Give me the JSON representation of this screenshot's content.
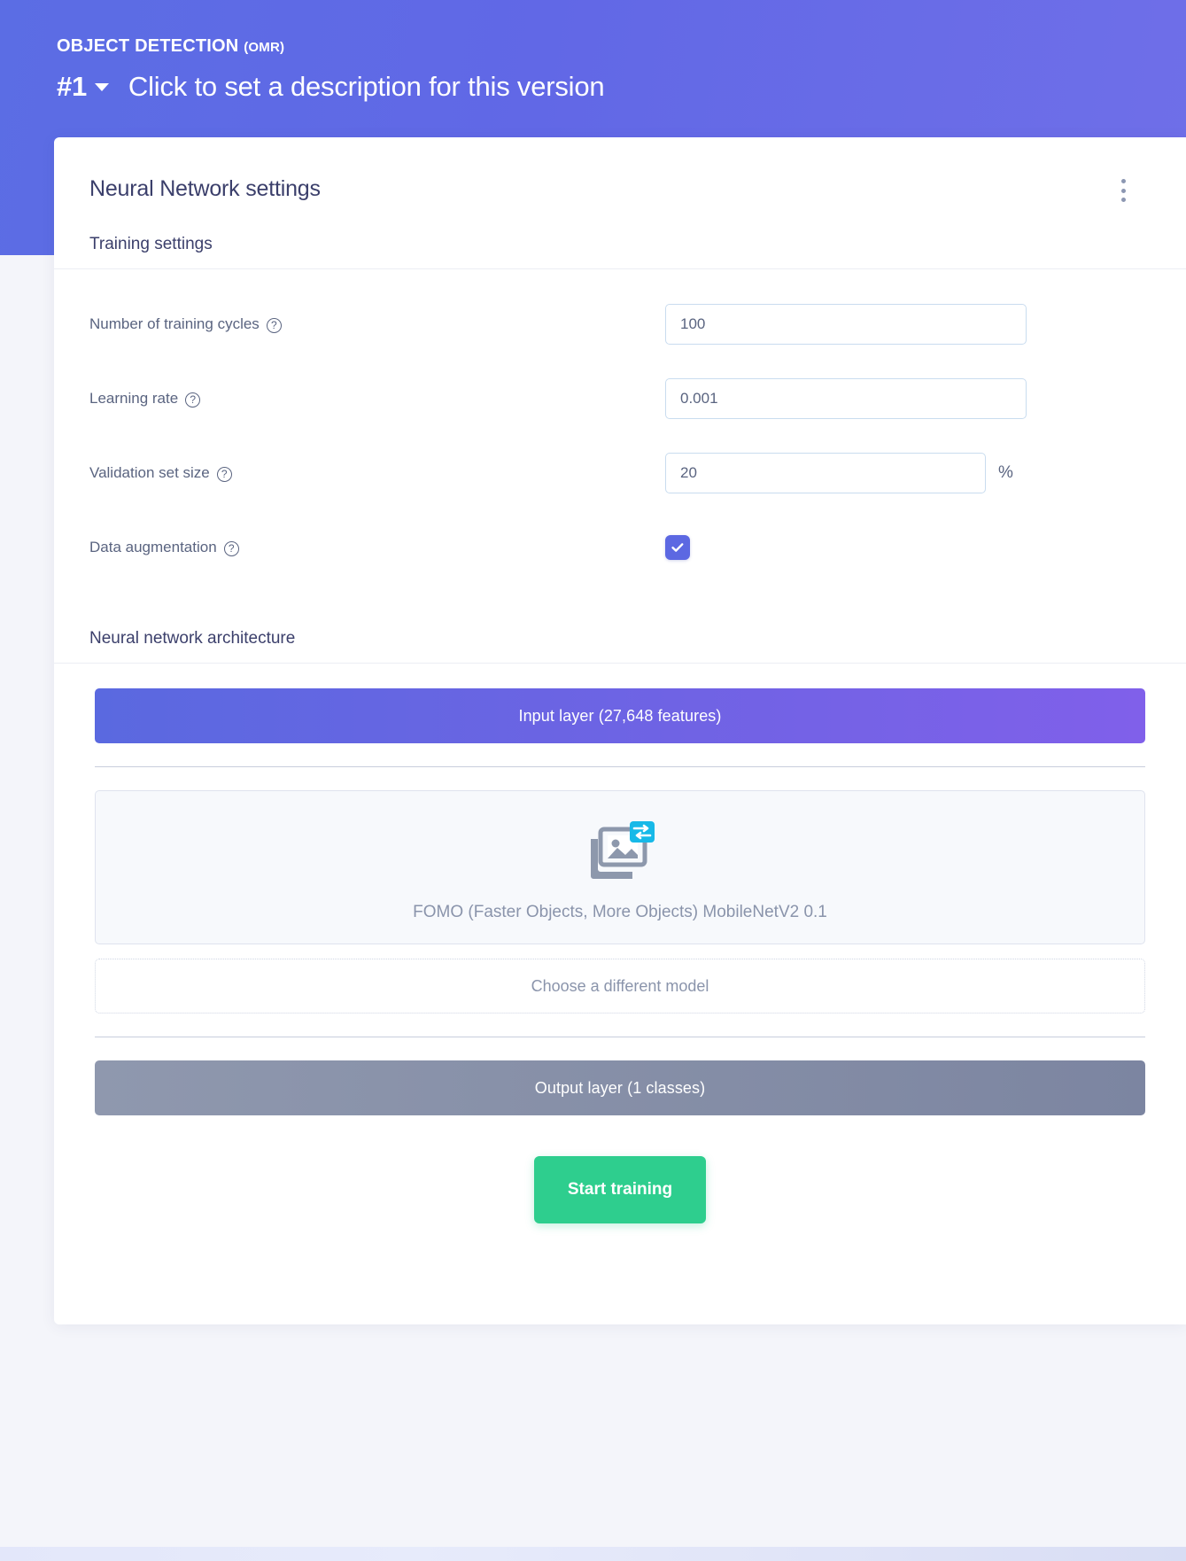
{
  "header": {
    "project_type": "OBJECT DETECTION",
    "project_suffix": "(OMR)",
    "version": "#1",
    "version_description": "Click to set a description for this version"
  },
  "card": {
    "title": "Neural Network settings",
    "menu_icon": "kebab-menu-icon"
  },
  "training_settings": {
    "section_title": "Training settings",
    "rows": [
      {
        "label": "Number of training cycles",
        "help": "?",
        "value": "100",
        "suffix": ""
      },
      {
        "label": "Learning rate",
        "help": "?",
        "value": "0.001",
        "suffix": ""
      },
      {
        "label": "Validation set size",
        "help": "?",
        "value": "20",
        "suffix": "%"
      },
      {
        "label": "Data augmentation",
        "help": "?",
        "value": "",
        "suffix": ""
      }
    ],
    "data_augmentation_checked": true
  },
  "architecture": {
    "section_title": "Neural network architecture",
    "input_layer": "Input layer (27,648 features)",
    "model_icon": "image-transfer-icon",
    "model_name": "FOMO (Faster Objects, More Objects) MobileNetV2 0.1",
    "choose_model": "Choose a different model",
    "output_layer": "Output layer (1 classes)"
  },
  "footer": {
    "start_training": "Start training"
  },
  "colors": {
    "header_purple": "#6168e6",
    "accent_indigo": "#5c68e2",
    "success_green": "#2ece8e",
    "output_gray": "#848da6",
    "badge_cyan": "#17b9e8"
  }
}
